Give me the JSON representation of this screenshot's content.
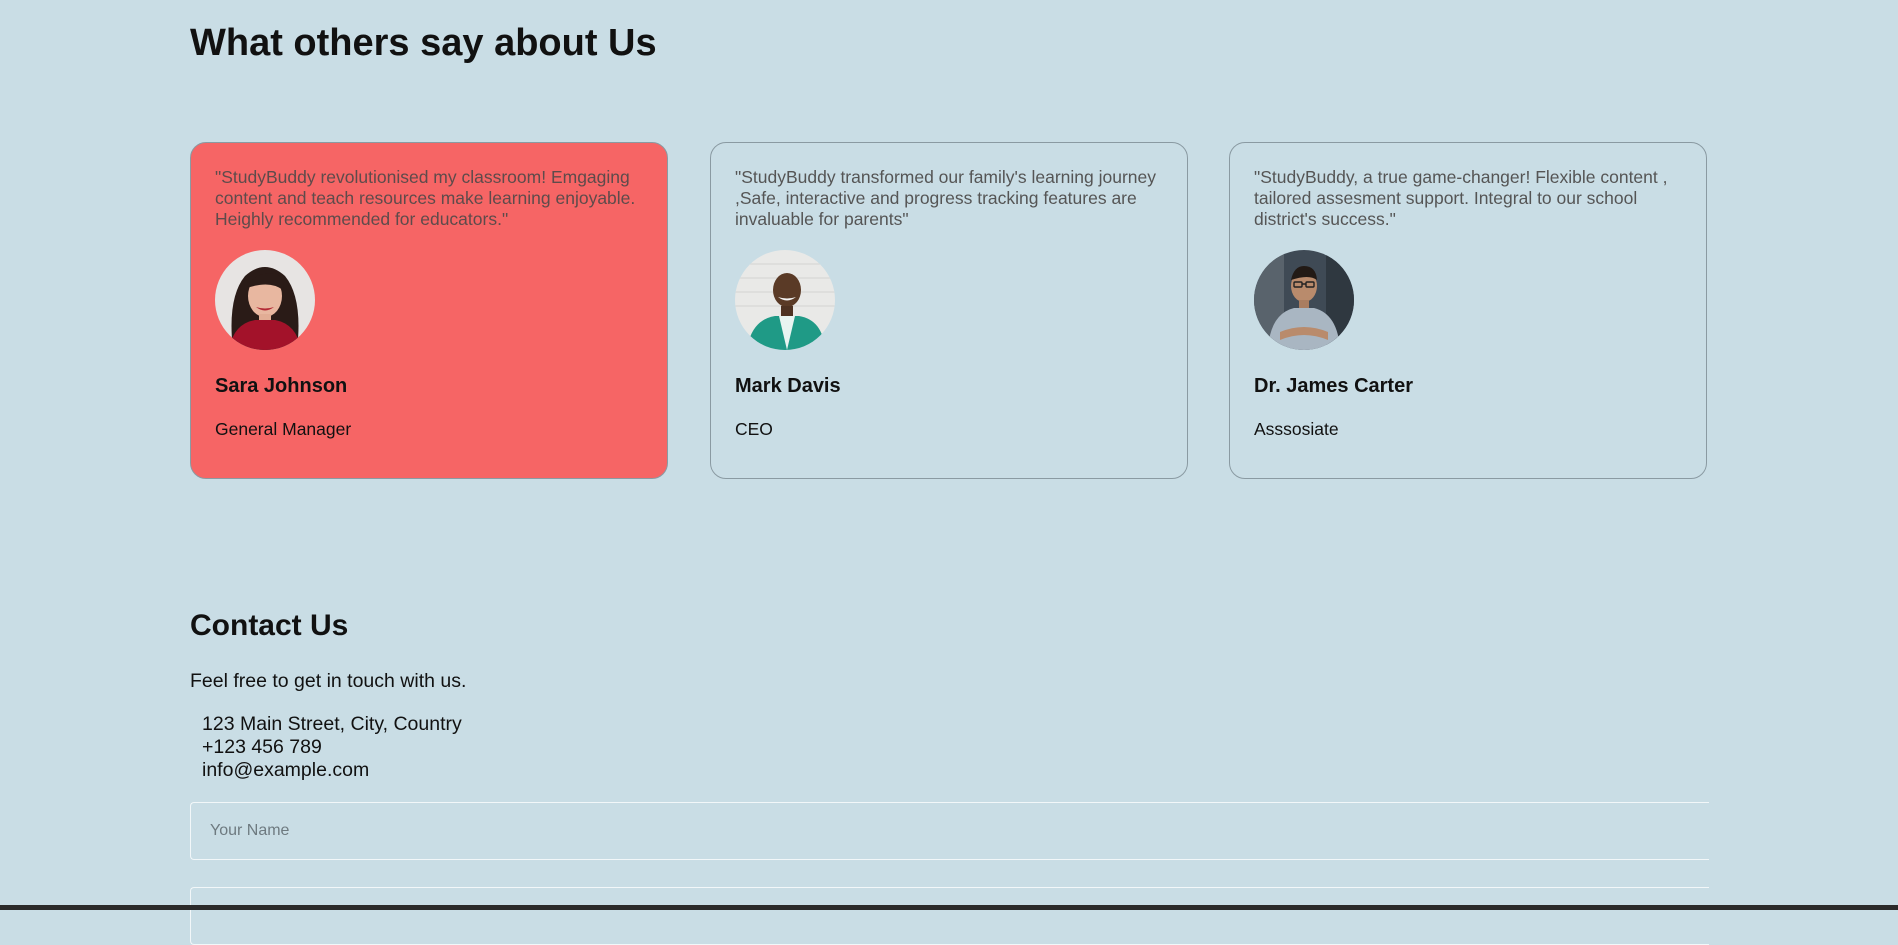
{
  "testimonials": {
    "title": "What others say about Us",
    "cards": [
      {
        "quote": "\"StudyBuddy revolutionised my classroom! Emgaging content and teach resources make learning enjoyable. Heighly recommended for educators.\"",
        "name": "Sara Johnson",
        "role": "General Manager",
        "highlighted": true,
        "background": "#f66565"
      },
      {
        "quote": "\"StudyBuddy transformed our family's learning journey ,Safe, interactive and progress tracking features are invaluable for parents\"",
        "name": "Mark Davis",
        "role": "CEO",
        "highlighted": false
      },
      {
        "quote": "\"StudyBuddy, a true game-changer! Flexible content , tailored assesment support. Integral to our school district's success.\"",
        "name": "Dr. James Carter",
        "role": "Asssosiate",
        "highlighted": false
      }
    ]
  },
  "contact": {
    "title": "Contact Us",
    "intro": "Feel free to get in touch with us.",
    "address": "123 Main Street, City, Country",
    "phone": "+123 456 789",
    "email": "info@example.com",
    "form": {
      "name_placeholder": "Your Name",
      "email_placeholder": ""
    }
  },
  "colors": {
    "page_background": "#c9dde5",
    "highlight_card": "#f66565"
  }
}
